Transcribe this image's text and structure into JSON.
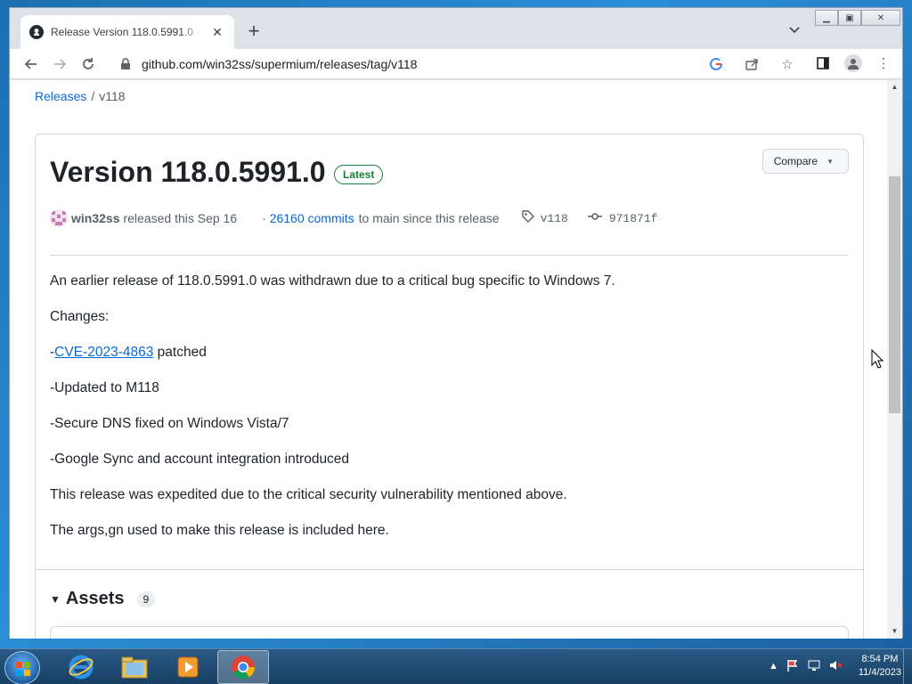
{
  "browser": {
    "tab_title": "Release Version 118.0.5991.0 · win32ss/supermium",
    "url": "github.com/win32ss/supermium/releases/tag/v118"
  },
  "breadcrumb": {
    "releases": "Releases",
    "separator": "/",
    "current": "v118"
  },
  "release": {
    "title": "Version 118.0.5991.0",
    "badge": "Latest",
    "compare_label": "Compare",
    "author": "win32ss",
    "released_text": "released this Sep 16",
    "dot": "·",
    "commits_link": "26160 commits",
    "commits_suffix": "to main since this release",
    "tag": "v118",
    "commit": "971871f"
  },
  "notes": {
    "p1": "An earlier release of 118.0.5991.0 was withdrawn due to a critical bug specific to Windows 7.",
    "p2": "Changes:",
    "p3_prefix": "-",
    "p3_link": "CVE-2023-4863",
    "p3_suffix": " patched",
    "p4": "-Updated to M118",
    "p5": "-Secure DNS fixed on Windows Vista/7",
    "p6": "-Google Sync and account integration introduced",
    "p7": "This release was expedited due to the critical security vulnerability mentioned above.",
    "p8": "The args,gn used to make this release is included here."
  },
  "assets": {
    "label": "Assets",
    "count": "9"
  },
  "taskbar": {
    "time": "8:54 PM",
    "date": "11/4/2023"
  },
  "colors": {
    "link": "#0969da",
    "latest_green": "#1a7f37"
  }
}
